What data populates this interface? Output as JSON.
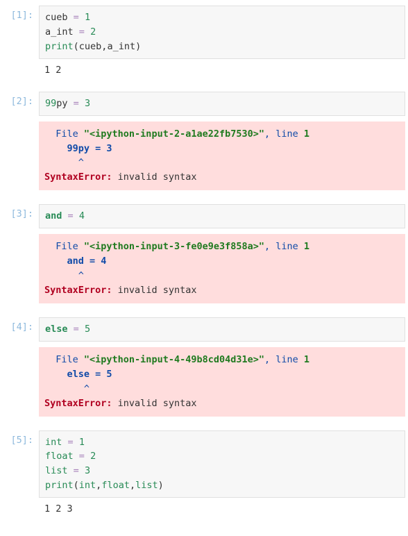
{
  "cells": [
    {
      "prompt": "[1]:",
      "code_tokens": [
        {
          "t": "cueb",
          "c": "tok-name"
        },
        {
          "t": " "
        },
        {
          "t": "=",
          "c": "tok-op"
        },
        {
          "t": " "
        },
        {
          "t": "1",
          "c": "tok-num"
        },
        {
          "t": "\n"
        },
        {
          "t": "a_int",
          "c": "tok-name"
        },
        {
          "t": " "
        },
        {
          "t": "=",
          "c": "tok-op"
        },
        {
          "t": " "
        },
        {
          "t": "2",
          "c": "tok-num"
        },
        {
          "t": "\n"
        },
        {
          "t": "print",
          "c": "tok-bi"
        },
        {
          "t": "(",
          "c": "tok-pun"
        },
        {
          "t": "cueb",
          "c": "tok-name"
        },
        {
          "t": ",",
          "c": "tok-pun"
        },
        {
          "t": "a_int",
          "c": "tok-name"
        },
        {
          "t": ")",
          "c": "tok-pun"
        }
      ],
      "stdout": "1 2"
    },
    {
      "prompt": "[2]:",
      "code_tokens": [
        {
          "t": "99",
          "c": "tok-num"
        },
        {
          "t": "py",
          "c": "tok-name"
        },
        {
          "t": " "
        },
        {
          "t": "=",
          "c": "tok-op"
        },
        {
          "t": " "
        },
        {
          "t": "3",
          "c": "tok-num"
        }
      ],
      "error_tokens": [
        {
          "t": "  File ",
          "c": "err-blue"
        },
        {
          "t": "\"<ipython-input-2-a1ae22fb7530>\"",
          "c": "err-green-b"
        },
        {
          "t": ", line ",
          "c": "err-blue"
        },
        {
          "t": "1",
          "c": "err-green-b"
        },
        {
          "t": "\n"
        },
        {
          "t": "    99py = 3",
          "c": "err-blue-b"
        },
        {
          "t": "\n"
        },
        {
          "t": "      ^",
          "c": "err-blue"
        },
        {
          "t": "\n"
        },
        {
          "t": "SyntaxError",
          "c": "err-red-b"
        },
        {
          "t": ":",
          "c": "err-red-b"
        },
        {
          "t": " invalid syntax",
          "c": "err-plain"
        }
      ]
    },
    {
      "prompt": "[3]:",
      "code_tokens": [
        {
          "t": "and",
          "c": "tok-kw"
        },
        {
          "t": " "
        },
        {
          "t": "=",
          "c": "tok-op"
        },
        {
          "t": " "
        },
        {
          "t": "4",
          "c": "tok-num"
        }
      ],
      "error_tokens": [
        {
          "t": "  File ",
          "c": "err-blue"
        },
        {
          "t": "\"<ipython-input-3-fe0e9e3f858a>\"",
          "c": "err-green-b"
        },
        {
          "t": ", line ",
          "c": "err-blue"
        },
        {
          "t": "1",
          "c": "err-green-b"
        },
        {
          "t": "\n"
        },
        {
          "t": "    and = 4",
          "c": "err-blue-b"
        },
        {
          "t": "\n"
        },
        {
          "t": "      ^",
          "c": "err-blue"
        },
        {
          "t": "\n"
        },
        {
          "t": "SyntaxError",
          "c": "err-red-b"
        },
        {
          "t": ":",
          "c": "err-red-b"
        },
        {
          "t": " invalid syntax",
          "c": "err-plain"
        }
      ]
    },
    {
      "prompt": "[4]:",
      "code_tokens": [
        {
          "t": "else",
          "c": "tok-kw"
        },
        {
          "t": " "
        },
        {
          "t": "=",
          "c": "tok-op"
        },
        {
          "t": " "
        },
        {
          "t": "5",
          "c": "tok-num"
        }
      ],
      "error_tokens": [
        {
          "t": "  File ",
          "c": "err-blue"
        },
        {
          "t": "\"<ipython-input-4-49b8cd04d31e>\"",
          "c": "err-green-b"
        },
        {
          "t": ", line ",
          "c": "err-blue"
        },
        {
          "t": "1",
          "c": "err-green-b"
        },
        {
          "t": "\n"
        },
        {
          "t": "    else = 5",
          "c": "err-blue-b"
        },
        {
          "t": "\n"
        },
        {
          "t": "       ^",
          "c": "err-blue"
        },
        {
          "t": "\n"
        },
        {
          "t": "SyntaxError",
          "c": "err-red-b"
        },
        {
          "t": ":",
          "c": "err-red-b"
        },
        {
          "t": " invalid syntax",
          "c": "err-plain"
        }
      ]
    },
    {
      "prompt": "[5]:",
      "code_tokens": [
        {
          "t": "int",
          "c": "tok-bi"
        },
        {
          "t": " "
        },
        {
          "t": "=",
          "c": "tok-op"
        },
        {
          "t": " "
        },
        {
          "t": "1",
          "c": "tok-num"
        },
        {
          "t": "\n"
        },
        {
          "t": "float",
          "c": "tok-bi"
        },
        {
          "t": " "
        },
        {
          "t": "=",
          "c": "tok-op"
        },
        {
          "t": " "
        },
        {
          "t": "2",
          "c": "tok-num"
        },
        {
          "t": "\n"
        },
        {
          "t": "list",
          "c": "tok-bi"
        },
        {
          "t": " "
        },
        {
          "t": "=",
          "c": "tok-op"
        },
        {
          "t": " "
        },
        {
          "t": "3",
          "c": "tok-num"
        },
        {
          "t": "\n"
        },
        {
          "t": "print",
          "c": "tok-bi"
        },
        {
          "t": "(",
          "c": "tok-pun"
        },
        {
          "t": "int",
          "c": "tok-bi"
        },
        {
          "t": ",",
          "c": "tok-pun"
        },
        {
          "t": "float",
          "c": "tok-bi"
        },
        {
          "t": ",",
          "c": "tok-pun"
        },
        {
          "t": "list",
          "c": "tok-bi"
        },
        {
          "t": ")",
          "c": "tok-pun"
        }
      ],
      "stdout": "1 2 3"
    }
  ]
}
